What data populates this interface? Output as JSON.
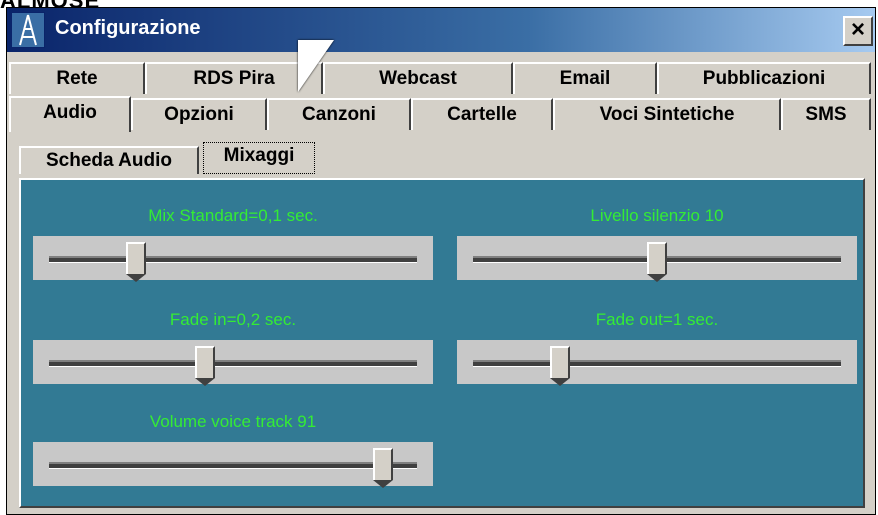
{
  "cut_title": "ALMOSE",
  "window": {
    "title": "Configurazione",
    "close_label": "×"
  },
  "tabs_row1": [
    "Rete",
    "RDS Pira",
    "Webcast",
    "Email",
    "Pubblicazioni"
  ],
  "tabs_row2": [
    "Audio",
    "Opzioni",
    "Canzoni",
    "Cartelle",
    "Voci Sintetiche",
    "SMS"
  ],
  "active_tab": "Audio",
  "subtabs": [
    "Scheda Audio",
    "Mixaggi"
  ],
  "active_subtab": "Mixaggi",
  "sliders": [
    {
      "label": "Mix Standard=0,1 sec.",
      "level": 0.22
    },
    {
      "label": "Livello silenzio 10",
      "level": 0.5
    },
    {
      "label": "Fade in=0,2 sec.",
      "level": 0.42
    },
    {
      "label": "Fade out=1 sec.",
      "level": 0.22
    },
    {
      "label": "Volume voice track 91",
      "level": 0.93
    }
  ],
  "colors": {
    "panel_bg": "#327a94",
    "label_green": "#34ec34"
  }
}
